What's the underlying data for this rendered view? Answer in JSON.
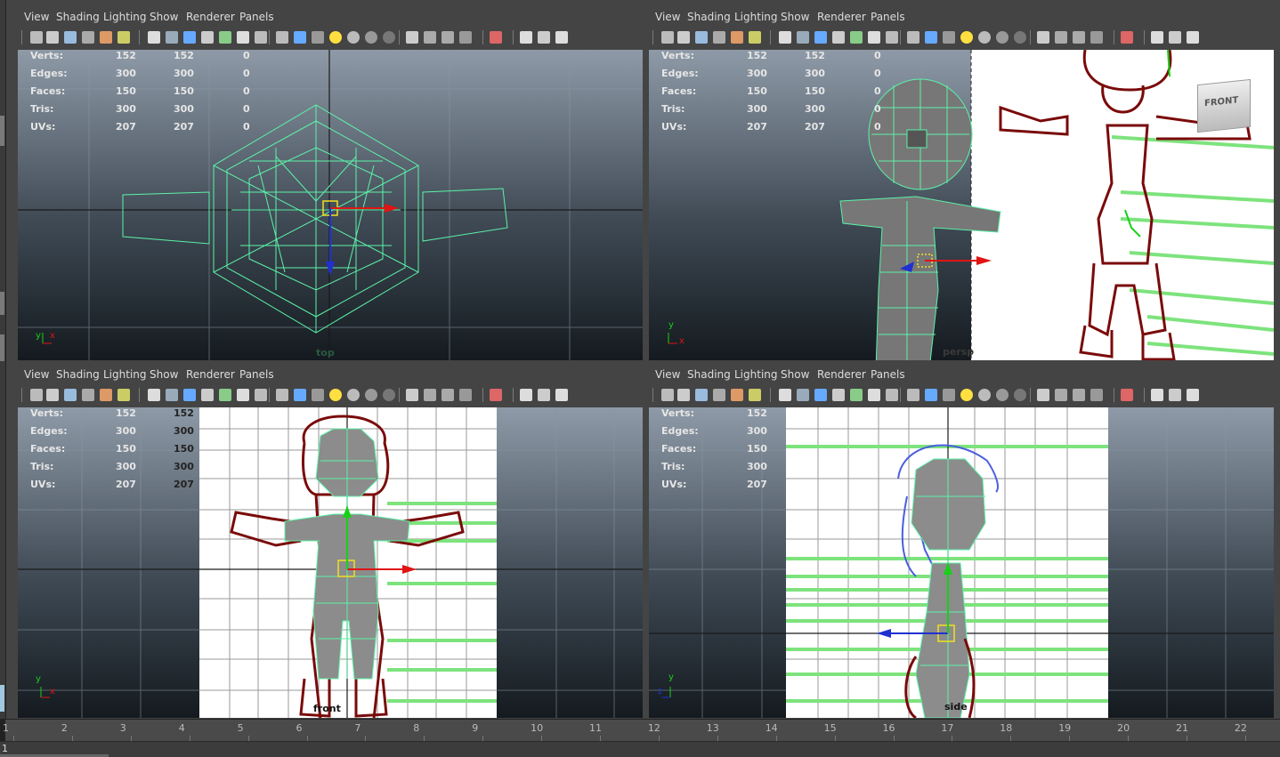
{
  "menu": [
    "View",
    "Shading",
    "Lighting",
    "Show",
    "Renderer",
    "Panels"
  ],
  "hud": {
    "labels": [
      "Verts:",
      "Edges:",
      "Faces:",
      "Tris:",
      "UVs:"
    ],
    "col1": [
      "152",
      "300",
      "150",
      "300",
      "207"
    ],
    "col2": [
      "152",
      "300",
      "150",
      "300",
      "207"
    ],
    "col3": [
      "0",
      "0",
      "0",
      "0",
      "0"
    ]
  },
  "panes": {
    "top": {
      "camera": "top"
    },
    "persp": {
      "camera": "persp",
      "viewcube": "FRONT"
    },
    "front": {
      "camera": "front"
    },
    "side": {
      "camera": "side"
    }
  },
  "axis": {
    "y": "y",
    "x": "x",
    "z": "z"
  },
  "timeline": {
    "ticks": [
      "1",
      "2",
      "3",
      "4",
      "5",
      "6",
      "7",
      "8",
      "9",
      "10",
      "11",
      "12",
      "13",
      "14",
      "15",
      "16",
      "17",
      "18",
      "19",
      "20",
      "21",
      "22"
    ],
    "current_frame": "1"
  },
  "colors": {
    "wire": "#5cf2a8",
    "sketch": "#7a0a0a",
    "hair_blue": "#4a5ee0",
    "guide_green": "#7de37d",
    "axis_red": "#e01414",
    "axis_blue": "#2030d0",
    "axis_green": "#18d018",
    "pivot_yellow": "#f0e020"
  },
  "icons": [
    "camera-select-icon",
    "camera-lock-icon",
    "bookmarks-icon",
    "image-plane-icon",
    "grease-pencil-icon",
    "camera-attr-icon",
    "wireframe-icon",
    "smooth-shade-icon",
    "default-material-icon",
    "bounding-box-icon",
    "textured-icon",
    "xray-icon",
    "light-icon",
    "isolate-icon",
    "grid-icon",
    "film-gate-icon",
    "resolution-gate-icon",
    "gate-mask-icon"
  ]
}
